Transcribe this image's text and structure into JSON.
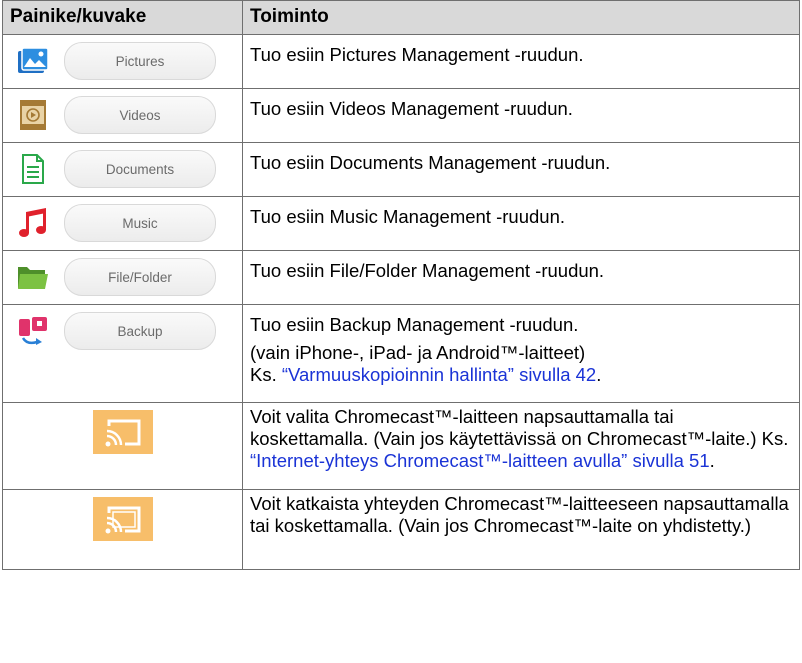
{
  "header": {
    "col1": "Painike/kuvake",
    "col2": "Toiminto"
  },
  "rows": [
    {
      "button_label": "Pictures",
      "icon": "pictures-icon",
      "text": "Tuo esiin Pictures Management -ruudun."
    },
    {
      "button_label": "Videos",
      "icon": "videos-icon",
      "text": "Tuo esiin Videos Management -ruudun."
    },
    {
      "button_label": "Documents",
      "icon": "documents-icon",
      "text": "Tuo esiin Documents Management -ruudun."
    },
    {
      "button_label": "Music",
      "icon": "music-icon",
      "text": "Tuo esiin Music Management -ruudun."
    },
    {
      "button_label": "File/Folder",
      "icon": "folder-icon",
      "text": "Tuo esiin File/Folder Management -ruudun."
    },
    {
      "button_label": "Backup",
      "icon": "backup-icon",
      "text": "Tuo esiin Backup Management -ruudun.",
      "note_line1": "(vain iPhone-, iPad- ja Android™-laitteet)",
      "note_prefix": "Ks. ",
      "note_link": "“Varmuuskopioinnin hallinta” sivulla 42",
      "note_suffix": "."
    }
  ],
  "cast_rows": [
    {
      "icon": "cast-icon",
      "text_before": "Voit valita Chromecast™-laitteen napsauttamalla tai koskettamalla. (Vain jos käytettävissä on Chromecast™-laite.) Ks. ",
      "link": "“Internet-yhteys Chromecast™-laitteen avulla” sivulla 51",
      "text_after": "."
    },
    {
      "icon": "cast-connected-icon",
      "text": "Voit katkaista yhteyden Chromecast™-laitteeseen napsauttamalla tai koskettamalla. (Vain jos Chromecast™-laite on yhdistetty.)"
    }
  ],
  "colors": {
    "header_bg": "#d9d9d9",
    "border": "#6f6f6f",
    "link": "#1a33d6",
    "cast_bg": "#f7be6a"
  }
}
